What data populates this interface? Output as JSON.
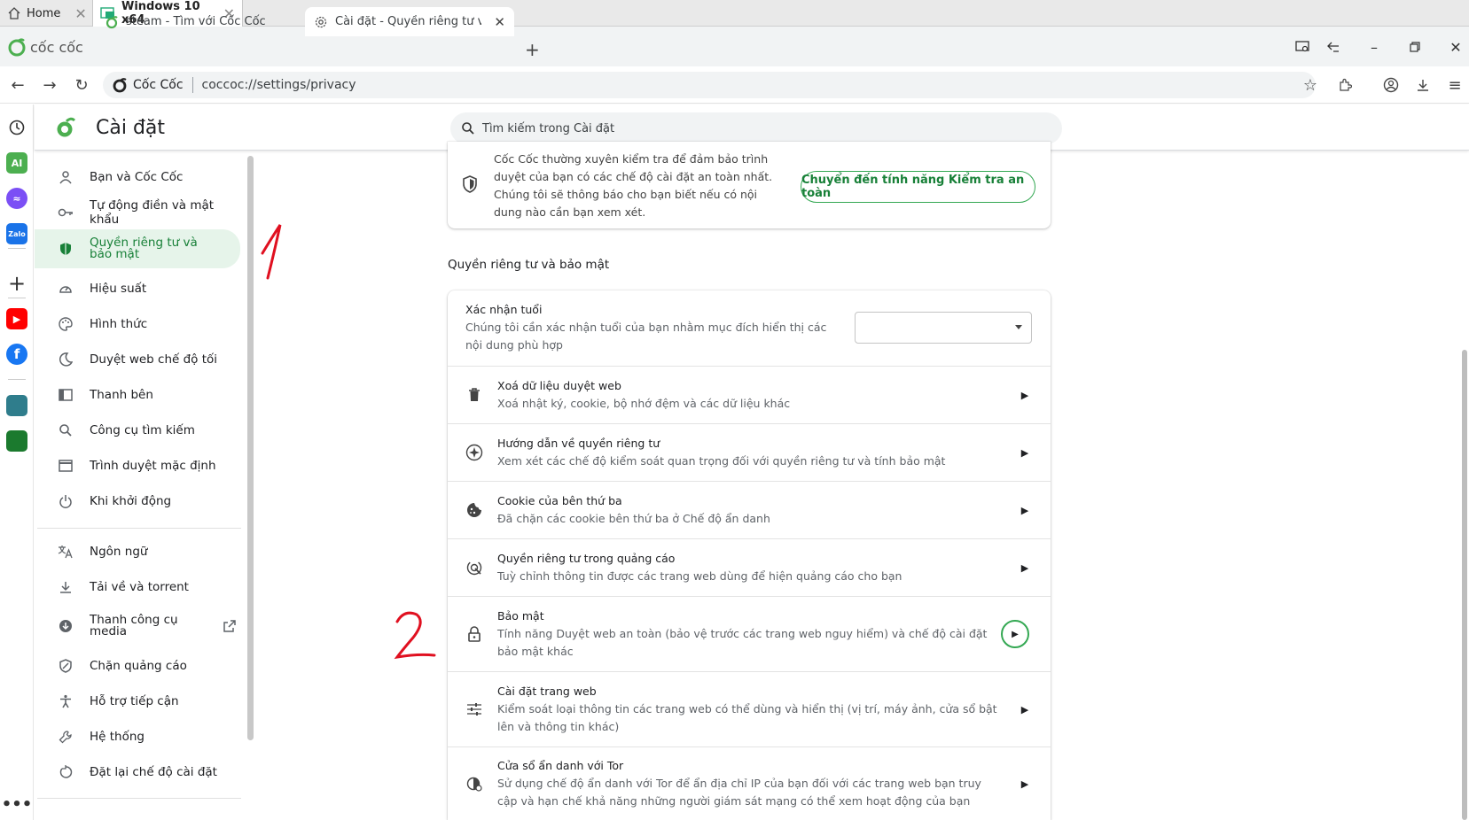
{
  "vm_tabs": [
    {
      "label": "Home"
    },
    {
      "label": "Windows 10 x64"
    }
  ],
  "browser": {
    "brand": "cốc cốc",
    "tabs": [
      {
        "label": "steam - Tìm với Cốc Cốc"
      },
      {
        "label": "Cài đặt - Quyền riêng tư và b"
      }
    ],
    "address": {
      "site_name": "Cốc Cốc",
      "url": "coccoc://settings/privacy"
    }
  },
  "rail": {
    "ai_label": "AI",
    "zalo_label": "Zalo"
  },
  "settings": {
    "title": "Cài đặt",
    "search_placeholder": "Tìm kiếm trong Cài đặt",
    "nav": [
      {
        "label": "Bạn và Cốc Cốc",
        "icon": "person-icon"
      },
      {
        "label": "Tự động điền và mật khẩu",
        "icon": "key-icon"
      },
      {
        "label": "Quyền riêng tư và bảo mật",
        "icon": "shield-icon",
        "active": true
      },
      {
        "label": "Hiệu suất",
        "icon": "gauge-icon"
      },
      {
        "label": "Hình thức",
        "icon": "palette-icon"
      },
      {
        "label": "Duyệt web chế độ tối",
        "icon": "moon-icon"
      },
      {
        "label": "Thanh bên",
        "icon": "sidebar-icon"
      },
      {
        "label": "Công cụ tìm kiếm",
        "icon": "search-icon"
      },
      {
        "label": "Trình duyệt mặc định",
        "icon": "browser-icon"
      },
      {
        "label": "Khi khởi động",
        "icon": "power-icon"
      },
      {
        "label": "Ngôn ngữ",
        "icon": "translate-icon"
      },
      {
        "label": "Tải về và torrent",
        "icon": "download-icon"
      },
      {
        "label": "Thanh công cụ media",
        "icon": "media-icon"
      },
      {
        "label": "Chặn quảng cáo",
        "icon": "adblock-icon"
      },
      {
        "label": "Hỗ trợ tiếp cận",
        "icon": "accessibility-icon"
      },
      {
        "label": "Hệ thống",
        "icon": "wrench-icon"
      },
      {
        "label": "Đặt lại chế độ cài đặt",
        "icon": "reset-icon"
      }
    ],
    "safety_check": {
      "text": "Cốc Cốc thường xuyên kiểm tra để đảm bảo trình duyệt của bạn có các chế độ cài đặt an toàn nhất. Chúng tôi sẽ thông báo cho bạn biết nếu có nội dung nào cần bạn xem xét.",
      "button": "Chuyển đến tính năng Kiểm tra an toàn"
    },
    "section_title": "Quyền riêng tư và bảo mật",
    "age": {
      "title": "Xác nhận tuổi",
      "subtitle": "Chúng tôi cần xác nhận tuổi của bạn nhằm mục đích hiển thị các nội dung phù hợp",
      "selected": ""
    },
    "rows": [
      {
        "title": "Xoá dữ liệu duyệt web",
        "subtitle": "Xoá nhật ký, cookie, bộ nhớ đệm và các dữ liệu khác"
      },
      {
        "title": "Hướng dẫn về quyền riêng tư",
        "subtitle": "Xem xét các chế độ kiểm soát quan trọng đối với quyền riêng tư và tính bảo mật"
      },
      {
        "title": "Cookie của bên thứ ba",
        "subtitle": "Đã chặn các cookie bên thứ ba ở Chế độ ẩn danh"
      },
      {
        "title": "Quyền riêng tư trong quảng cáo",
        "subtitle": "Tuỳ chỉnh thông tin được các trang web dùng để hiện quảng cáo cho bạn"
      },
      {
        "title": "Bảo mật",
        "subtitle": "Tính năng Duyệt web an toàn (bảo vệ trước các trang web nguy hiểm) và chế độ cài đặt bảo mật khác"
      },
      {
        "title": "Cài đặt trang web",
        "subtitle": "Kiểm soát loại thông tin các trang web có thể dùng và hiển thị (vị trí, máy ảnh, cửa sổ bật lên và thông tin khác)"
      },
      {
        "title": "Cửa sổ ẩn danh với Tor",
        "subtitle": "Sử dụng chế độ ẩn danh với Tor để ẩn địa chỉ IP của bạn đối với các trang web bạn truy cập và hạn chế khả năng những người giám sát mạng có thể xem hoạt động của bạn"
      }
    ]
  },
  "annotations": [
    "1",
    "2"
  ],
  "colors": {
    "accent_green": "#188038",
    "annotation_red": "#e01020"
  }
}
